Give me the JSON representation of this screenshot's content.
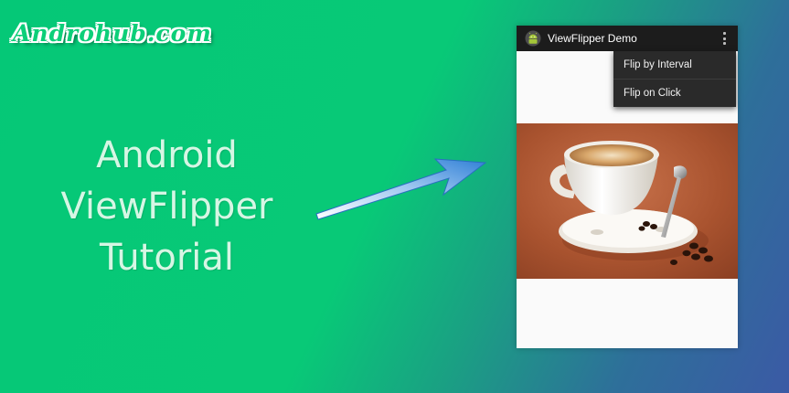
{
  "brand": {
    "text": "Androhub.com"
  },
  "headline": {
    "line1": "Android",
    "line2": "ViewFlipper",
    "line3": "Tutorial"
  },
  "app": {
    "title": "ViewFlipper Demo",
    "icon": "android-icon",
    "menu": [
      {
        "label": "Flip by Interval"
      },
      {
        "label": "Flip on Click"
      }
    ],
    "image": "coffee-cup-photo"
  },
  "colors": {
    "background_start": "#05c877",
    "background_end": "#3b5aa5",
    "action_bar": "#1c1c1c",
    "menu": "#2a2a2a",
    "arrow": "#3c86d6"
  }
}
